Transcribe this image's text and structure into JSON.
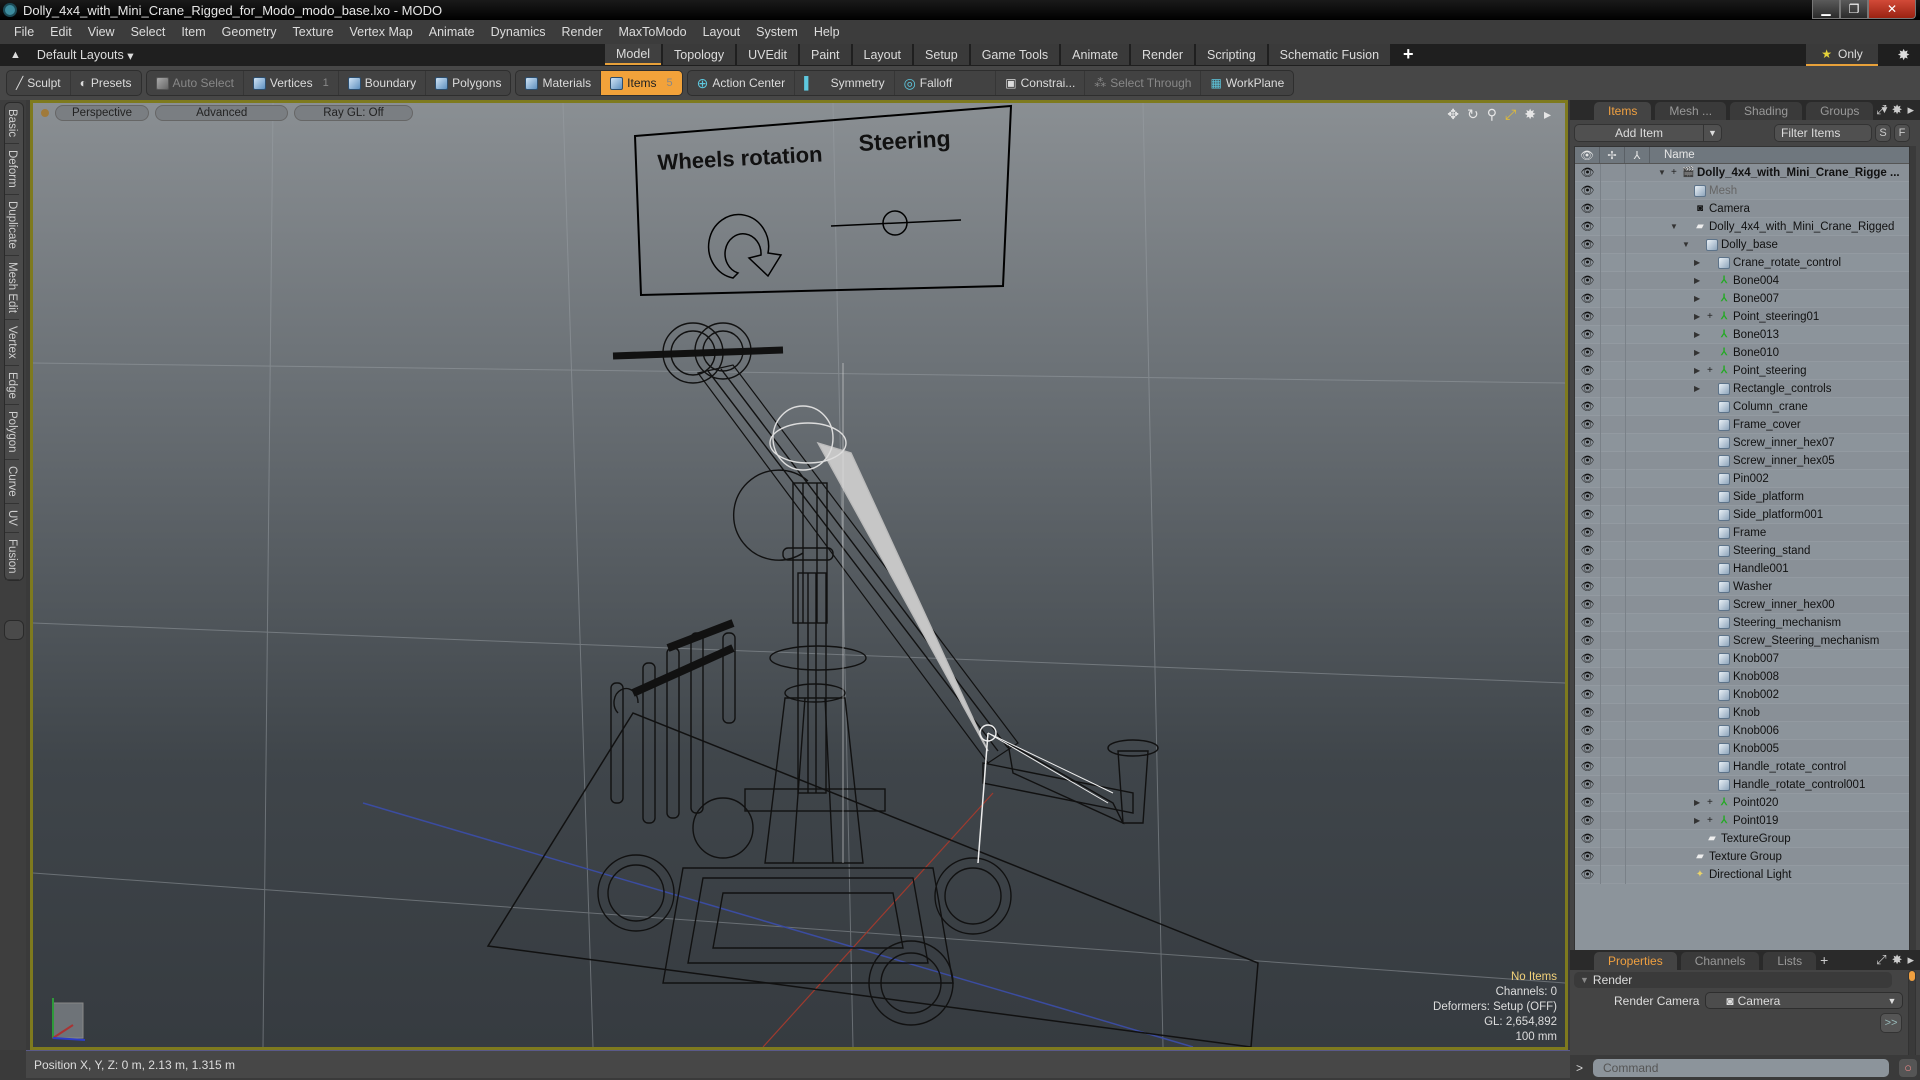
{
  "window": {
    "title": "Dolly_4x4_with_Mini_Crane_Rigged_for_Modo_modo_base.lxo - MODO",
    "controls": [
      "minimize",
      "maximize",
      "close"
    ]
  },
  "menu": [
    "File",
    "Edit",
    "View",
    "Select",
    "Item",
    "Geometry",
    "Texture",
    "Vertex Map",
    "Animate",
    "Dynamics",
    "Render",
    "MaxToModo",
    "Layout",
    "System",
    "Help"
  ],
  "layout": {
    "label": "Default Layouts",
    "tabs": [
      "Model",
      "Topology",
      "UVEdit",
      "Paint",
      "Layout",
      "Setup",
      "Game Tools",
      "Animate",
      "Render",
      "Scripting",
      "Schematic Fusion"
    ],
    "active_tab": "Model",
    "only_label": "Only"
  },
  "toolbar": {
    "sculpt": "Sculpt",
    "presets": "Presets",
    "auto_select": "Auto Select",
    "vertices": "Vertices",
    "vertices_count": "1",
    "boundary": "Boundary",
    "polygons": "Polygons",
    "materials": "Materials",
    "items": "Items",
    "items_count": "5",
    "action_center": "Action Center",
    "symmetry": "Symmetry",
    "falloff": "Falloff",
    "constraints": "Constrai...",
    "select_through": "Select Through",
    "workplane": "WorkPlane"
  },
  "left_tabs": [
    "Basic",
    "Deform",
    "Duplicate",
    "Mesh Edit",
    "Vertex",
    "Edge",
    "Polygon",
    "Curve",
    "UV",
    "Fusion"
  ],
  "viewport": {
    "view_mode": "Perspective",
    "shading": "Advanced",
    "raygl": "Ray GL: Off",
    "overlay": {
      "wheels_label": "Wheels rotation",
      "steering_label": "Steering"
    },
    "info": {
      "selection": "No Items",
      "channels": "Channels: 0",
      "deformers": "Deformers: Setup (OFF)",
      "gl": "GL: 2,654,892",
      "grid": "100 mm"
    }
  },
  "status": {
    "position": "Position X, Y, Z:   0 m, 2.13 m, 1.315 m"
  },
  "items_panel": {
    "tabs": [
      "Items",
      "Mesh ...",
      "Shading",
      "Groups"
    ],
    "active": "Items",
    "add_item": "Add Item",
    "filter_placeholder": "Filter Items",
    "s_btn": "S",
    "f_btn": "F",
    "name_col": "Name",
    "rows": [
      {
        "name": "Dolly_4x4_with_Mini_Crane_Rigge ...",
        "icon": "scene",
        "depth": 0,
        "arrow": "down",
        "plus": true,
        "bold": true
      },
      {
        "name": "Mesh",
        "icon": "mesh",
        "depth": 1,
        "dim": true
      },
      {
        "name": "Camera",
        "icon": "cam",
        "depth": 1
      },
      {
        "name": "Dolly_4x4_with_Mini_Crane_Rigged",
        "icon": "grp",
        "depth": 1,
        "arrow": "down"
      },
      {
        "name": "Dolly_base",
        "icon": "mesh",
        "depth": 2,
        "arrow": "down"
      },
      {
        "name": "Crane_rotate_control",
        "icon": "mesh",
        "depth": 3,
        "arrow": "right"
      },
      {
        "name": "Bone004",
        "icon": "loc",
        "depth": 3,
        "arrow": "right"
      },
      {
        "name": "Bone007",
        "icon": "loc",
        "depth": 3,
        "arrow": "right"
      },
      {
        "name": "Point_steering01",
        "icon": "loc",
        "depth": 3,
        "arrow": "right",
        "plus": true
      },
      {
        "name": "Bone013",
        "icon": "loc",
        "depth": 3,
        "arrow": "right"
      },
      {
        "name": "Bone010",
        "icon": "loc",
        "depth": 3,
        "arrow": "right"
      },
      {
        "name": "Point_steering",
        "icon": "loc",
        "depth": 3,
        "arrow": "right",
        "plus": true
      },
      {
        "name": "Rectangle_controls",
        "icon": "mesh",
        "depth": 3,
        "arrow": "right"
      },
      {
        "name": "Column_crane",
        "icon": "mesh",
        "depth": 3
      },
      {
        "name": "Frame_cover",
        "icon": "mesh",
        "depth": 3
      },
      {
        "name": "Screw_inner_hex07",
        "icon": "mesh",
        "depth": 3
      },
      {
        "name": "Screw_inner_hex05",
        "icon": "mesh",
        "depth": 3
      },
      {
        "name": "Pin002",
        "icon": "mesh",
        "depth": 3
      },
      {
        "name": "Side_platform",
        "icon": "mesh",
        "depth": 3
      },
      {
        "name": "Side_platform001",
        "icon": "mesh",
        "depth": 3
      },
      {
        "name": "Frame",
        "icon": "mesh",
        "depth": 3
      },
      {
        "name": "Steering_stand",
        "icon": "mesh",
        "depth": 3
      },
      {
        "name": "Handle001",
        "icon": "mesh",
        "depth": 3
      },
      {
        "name": "Washer",
        "icon": "mesh",
        "depth": 3
      },
      {
        "name": "Screw_inner_hex00",
        "icon": "mesh",
        "depth": 3
      },
      {
        "name": "Steering_mechanism",
        "icon": "mesh",
        "depth": 3
      },
      {
        "name": "Screw_Steering_mechanism",
        "icon": "mesh",
        "depth": 3
      },
      {
        "name": "Knob007",
        "icon": "mesh",
        "depth": 3
      },
      {
        "name": "Knob008",
        "icon": "mesh",
        "depth": 3
      },
      {
        "name": "Knob002",
        "icon": "mesh",
        "depth": 3
      },
      {
        "name": "Knob",
        "icon": "mesh",
        "depth": 3
      },
      {
        "name": "Knob006",
        "icon": "mesh",
        "depth": 3
      },
      {
        "name": "Knob005",
        "icon": "mesh",
        "depth": 3
      },
      {
        "name": "Handle_rotate_control",
        "icon": "mesh",
        "depth": 3
      },
      {
        "name": "Handle_rotate_control001",
        "icon": "mesh",
        "depth": 3
      },
      {
        "name": "Point020",
        "icon": "loc",
        "depth": 3,
        "arrow": "right",
        "plus": true
      },
      {
        "name": "Point019",
        "icon": "loc",
        "depth": 3,
        "arrow": "right",
        "plus": true
      },
      {
        "name": "TextureGroup",
        "icon": "grp",
        "depth": 2
      },
      {
        "name": "Texture Group",
        "icon": "grp",
        "depth": 1
      },
      {
        "name": "Directional Light",
        "icon": "light",
        "depth": 1
      }
    ]
  },
  "properties_panel": {
    "tabs": [
      "Properties",
      "Channels",
      "Lists"
    ],
    "active": "Properties",
    "section": "Render",
    "render_camera_label": "Render Camera",
    "render_camera_value": "Camera",
    "more": ">>"
  },
  "command": {
    "placeholder": "Command",
    "prompt": ">"
  },
  "colors": {
    "accent": "#f2a23a",
    "viewport_border": "#7e7a1e"
  }
}
